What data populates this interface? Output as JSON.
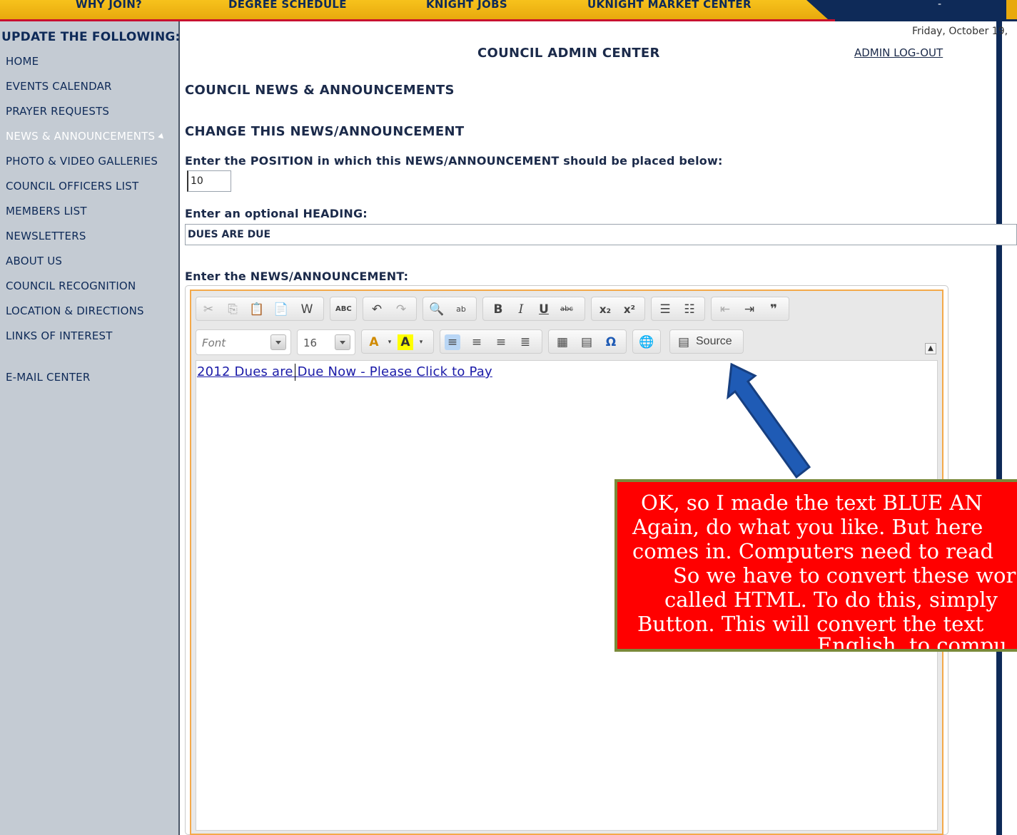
{
  "top_nav": {
    "items": [
      "WHY JOIN?",
      "DEGREE SCHEDULE",
      "KNIGHT JOBS",
      "UKNIGHT MARKET CENTER"
    ],
    "right_text": "-"
  },
  "sidebar": {
    "header": "UPDATE THE FOLLOWING:",
    "items": [
      {
        "label": "HOME"
      },
      {
        "label": "EVENTS CALENDAR"
      },
      {
        "label": "PRAYER REQUESTS"
      },
      {
        "label": "NEWS & ANNOUNCEMENTS"
      },
      {
        "label": "PHOTO & VIDEO GALLERIES"
      },
      {
        "label": "COUNCIL OFFICERS LIST"
      },
      {
        "label": "MEMBERS LIST"
      },
      {
        "label": "NEWSLETTERS"
      },
      {
        "label": "ABOUT US"
      },
      {
        "label": "COUNCIL RECOGNITION"
      },
      {
        "label": "LOCATION & DIRECTIONS"
      },
      {
        "label": "LINKS OF INTEREST"
      },
      {
        "label": "E-MAIL CENTER"
      }
    ],
    "active_item": "NEWS & ANNOUNCEMENTS"
  },
  "header": {
    "date": "Friday, October 1",
    "date_tail": "9,",
    "title": "COUNCIL ADMIN CENTER",
    "logout": "ADMIN LOG-OUT"
  },
  "main": {
    "section_title": "COUNCIL NEWS & ANNOUNCEMENTS",
    "subsection_title": "CHANGE THIS NEWS/ANNOUNCEMENT",
    "position_label": "Enter the POSITION in which this NEWS/ANNOUNCEMENT should be placed below:",
    "position_value": "10",
    "heading_label": "Enter an optional HEADING:",
    "heading_value": "DUES ARE DUE",
    "announcement_label": "Enter the NEWS/ANNOUNCEMENT:"
  },
  "editor": {
    "font_placeholder": "Font",
    "font_size": "16",
    "source_label": "Source",
    "content_link": "2012 Dues are Due Now - Please Click to Pay",
    "toolbar_icons": [
      "cut-icon",
      "copy-icon",
      "paste-icon",
      "paste-text-icon",
      "paste-word-icon",
      "spellcheck-icon",
      "undo-icon",
      "redo-icon",
      "find-icon",
      "replace-icon",
      "bold-icon",
      "italic-icon",
      "underline-icon",
      "strikethrough-icon",
      "subscript-icon",
      "superscript-icon",
      "numbered-list-icon",
      "bulleted-list-icon",
      "outdent-icon",
      "indent-icon",
      "blockquote-icon",
      "text-color-icon",
      "background-color-icon",
      "align-left-icon",
      "align-center-icon",
      "align-right-icon",
      "justify-icon",
      "table-icon",
      "horizontal-rule-icon",
      "special-char-icon",
      "link-icon",
      "source-icon"
    ]
  },
  "annotation": {
    "lines": [
      "OK, so I made the text BLUE AN",
      "Again, do what you like. But here",
      "comes in. Computers need to read",
      "So we have to convert these wor",
      "called HTML. To do this, simply",
      "Button. This will convert the text",
      "English, to compu"
    ],
    "colors": {
      "box": "#ff0000",
      "border": "#7a8a3a",
      "arrow": "#1f5bb5"
    }
  }
}
